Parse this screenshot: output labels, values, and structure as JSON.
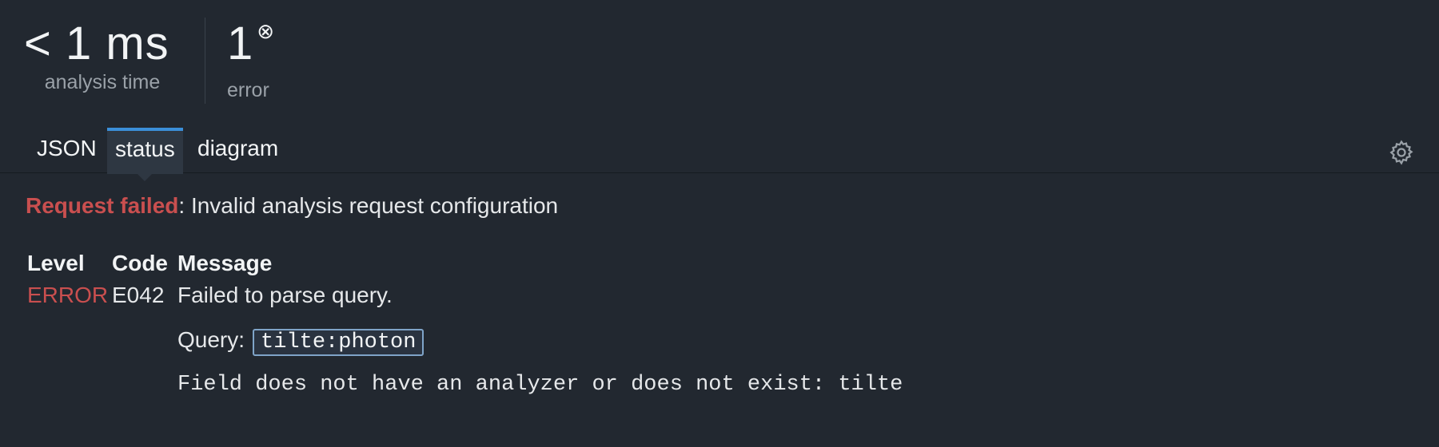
{
  "stats": {
    "time_value": "< 1 ms",
    "time_label": "analysis time",
    "error_value": "1",
    "error_icon": "circle-x-icon",
    "error_label": "error"
  },
  "tabs": [
    {
      "label": "JSON",
      "active": false
    },
    {
      "label": "status",
      "active": true
    },
    {
      "label": "diagram",
      "active": false
    }
  ],
  "toolbar": {
    "settings_icon": "gear-icon"
  },
  "status": {
    "headline_prefix": "Request failed",
    "headline_text": ": Invalid analysis request configuration",
    "columns": [
      "Level",
      "Code",
      "Message"
    ],
    "rows": [
      {
        "level": "ERROR",
        "code": "E042",
        "message": "Failed to parse query.",
        "query_label": "Query:",
        "query_value": "tilte:photon",
        "detail": "Field does not have an analyzer or does not exist: tilte"
      }
    ]
  },
  "colors": {
    "background": "#222830",
    "accent": "#3b8fd9",
    "error": "#c94f4f"
  }
}
